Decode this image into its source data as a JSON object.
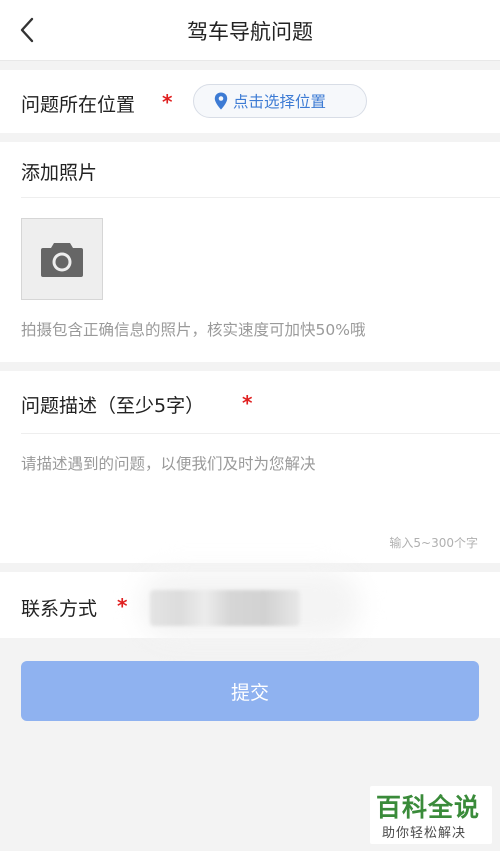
{
  "header": {
    "title": "驾车导航问题",
    "back_icon": "chevron-left-icon"
  },
  "location": {
    "label": "问题所在位置",
    "required_mark": "*",
    "button_label": "点击选择位置",
    "button_icon": "location-pin-icon",
    "accent": "#3d7bd4"
  },
  "photos": {
    "label": "添加照片",
    "add_icon": "camera-icon",
    "hint": "拍摄包含正确信息的照片，核实速度可加快50%哦"
  },
  "description": {
    "label": "问题描述（至少5字）",
    "required_mark": "*",
    "placeholder": "请描述遇到的问题，以便我们及时为您解决",
    "value": "",
    "counter": "输入5~300个字"
  },
  "contact": {
    "label": "联系方式",
    "required_mark": "*"
  },
  "submit": {
    "label": "提交",
    "color": "#8fb2f0"
  },
  "watermark": {
    "title": "百科全说",
    "subtitle": "助你轻松解决"
  }
}
